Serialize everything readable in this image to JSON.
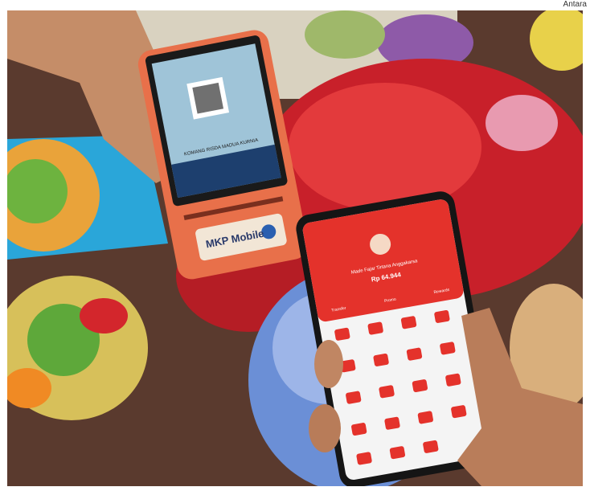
{
  "photo_credit": "Antara",
  "pos_device": {
    "brand_label": "MKP Mobile",
    "screen_caption": "KOMANG RISDA MADUA KURNIA"
  },
  "phone_app": {
    "user_name": "Made Fajar Tirtana Anggakarsa",
    "balance": "Rp 64.944",
    "tabs": [
      "Transfer",
      "Promo",
      "Rewards"
    ]
  },
  "colors": {
    "app_red": "#e4322b",
    "device_orange": "#e8704a",
    "hydrangea_blue": "#6b8fd6",
    "tray_blue": "#2aa6d9"
  }
}
